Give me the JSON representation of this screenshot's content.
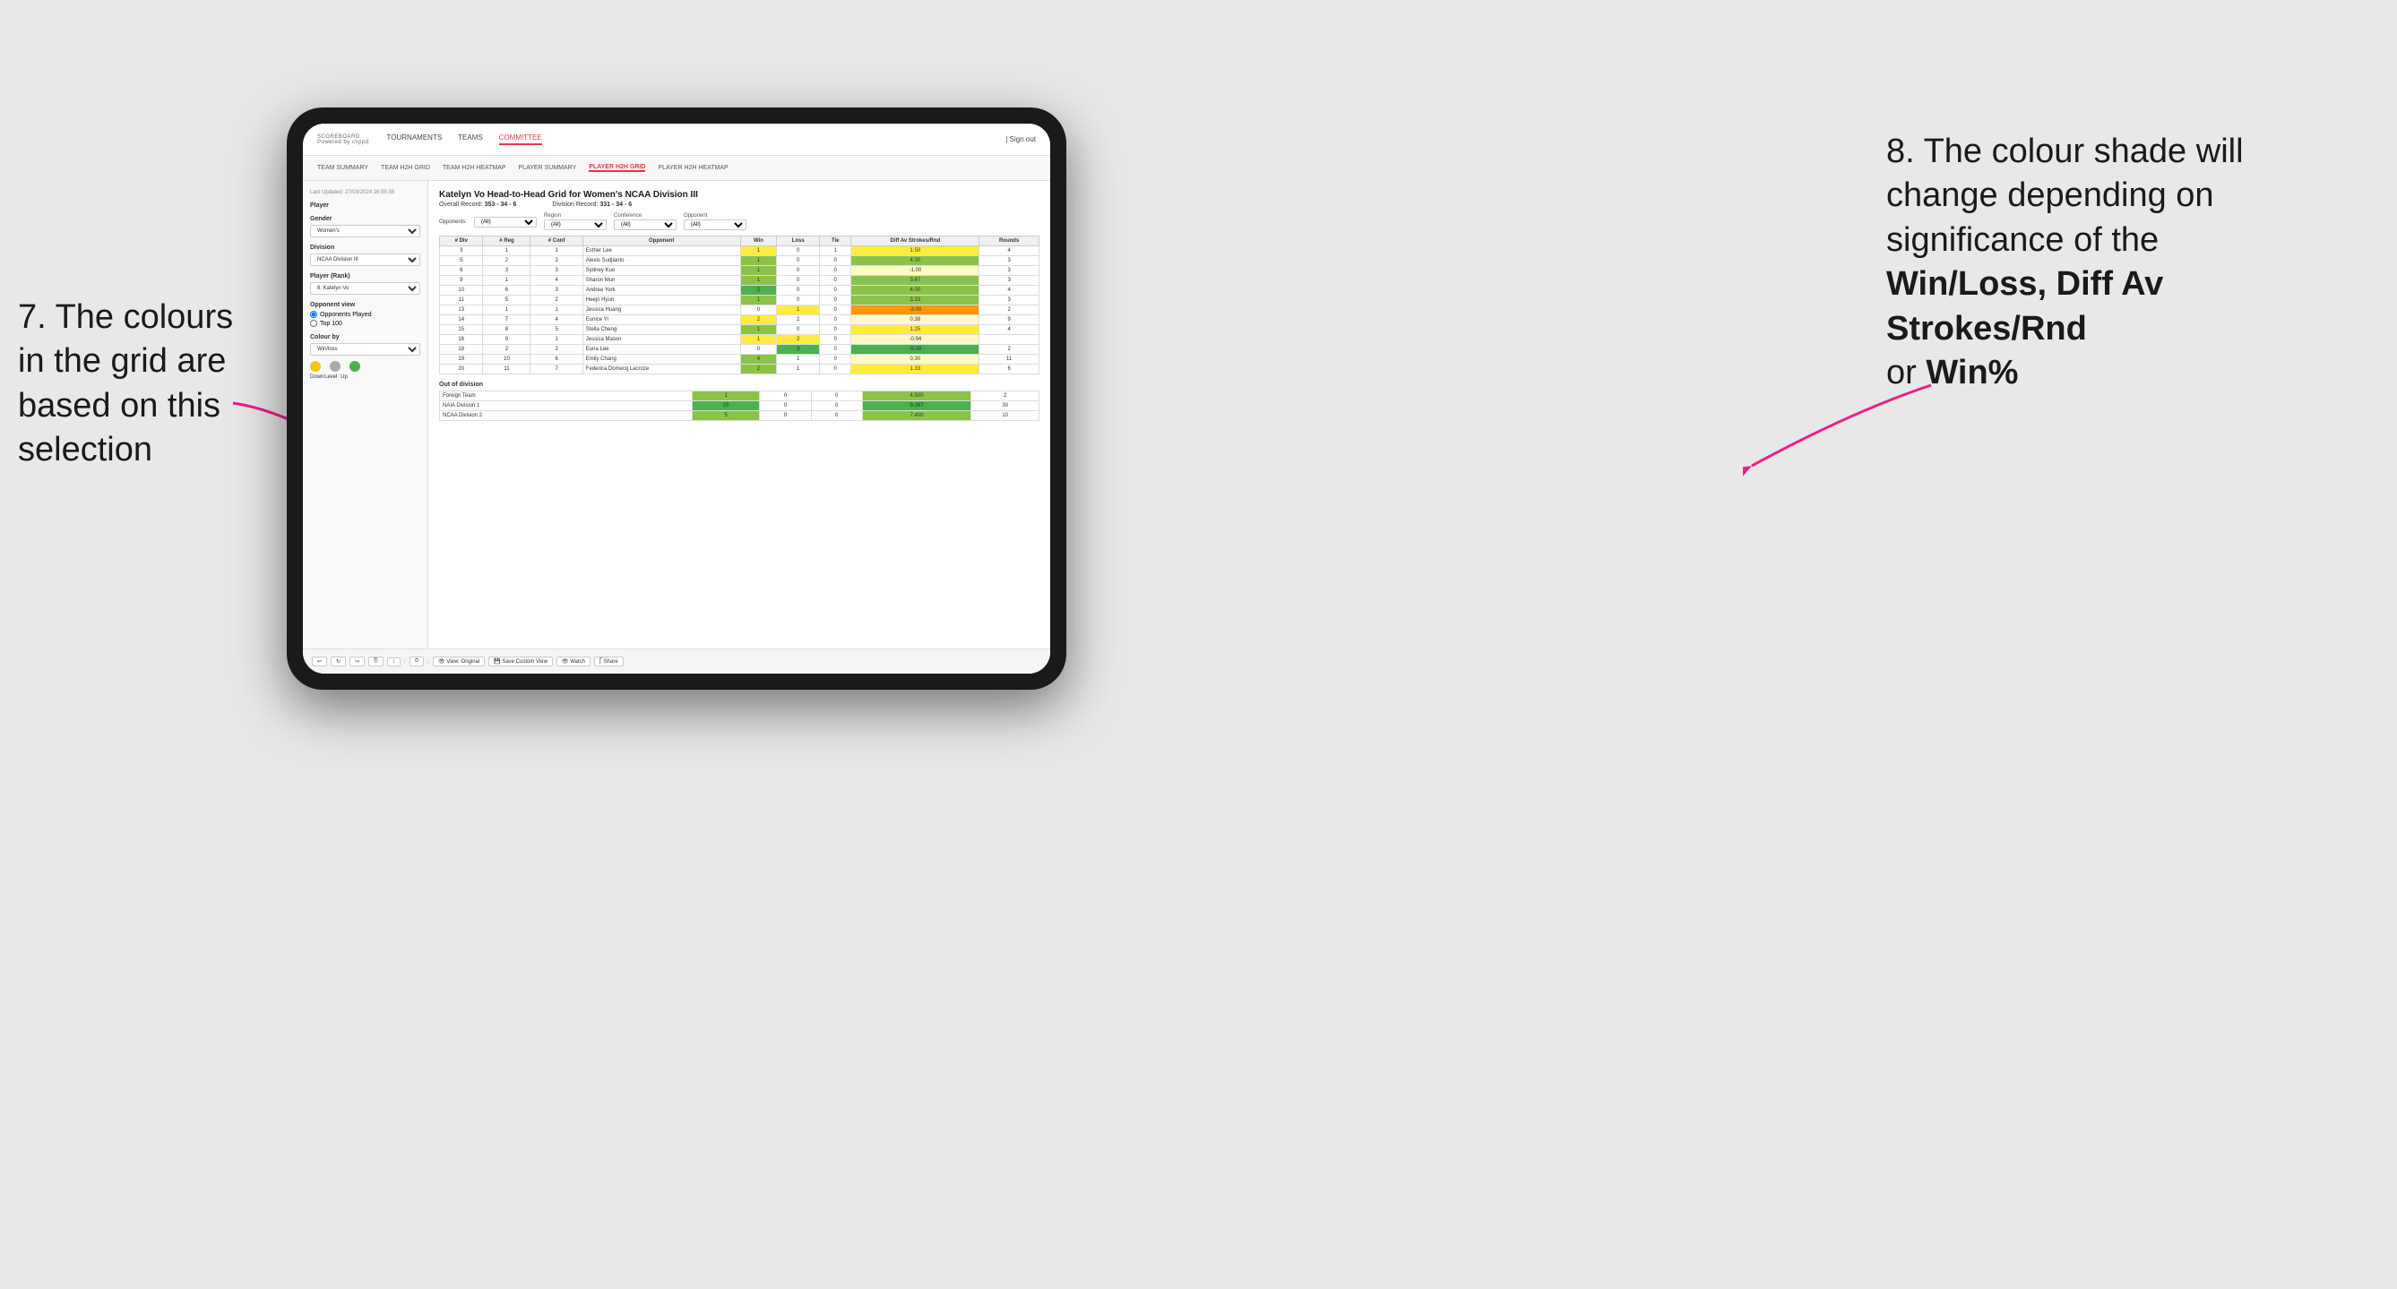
{
  "annotations": {
    "left_title": "7. The colours in the grid are based on this selection",
    "right_title": "8. The colour shade will change depending on significance of the",
    "right_bold1": "Win/Loss,",
    "right_bold2": "Diff Av Strokes/Rnd",
    "right_or": "or",
    "right_bold3": "Win%"
  },
  "nav": {
    "logo": "SCOREBOARD",
    "logo_sub": "Powered by clippd",
    "links": [
      "TOURNAMENTS",
      "TEAMS",
      "COMMITTEE"
    ],
    "active_link": "COMMITTEE",
    "right": "| Sign out"
  },
  "sub_nav": {
    "links": [
      "TEAM SUMMARY",
      "TEAM H2H GRID",
      "TEAM H2H HEATMAP",
      "PLAYER SUMMARY",
      "PLAYER H2H GRID",
      "PLAYER H2H HEATMAP"
    ],
    "active": "PLAYER H2H GRID"
  },
  "sidebar": {
    "timestamp": "Last Updated: 27/03/2024 16:55:38",
    "player_label": "Player",
    "gender_label": "Gender",
    "gender_value": "Women's",
    "division_label": "Division",
    "division_value": "NCAA Division III",
    "player_rank_label": "Player (Rank)",
    "player_rank_value": "8. Katelyn Vo",
    "opponent_view_label": "Opponent view",
    "opponent_played": "Opponents Played",
    "top_100": "Top 100",
    "colour_by_label": "Colour by",
    "colour_by_value": "Win/loss",
    "dots": [
      "Down",
      "Level",
      "Up"
    ]
  },
  "grid": {
    "title": "Katelyn Vo Head-to-Head Grid for Women's NCAA Division III",
    "overall_record_label": "Overall Record:",
    "overall_record": "353 - 34 - 6",
    "division_record_label": "Division Record:",
    "division_record": "331 - 34 - 6",
    "filters": {
      "opponents_label": "Opponents:",
      "opponents_value": "(All)",
      "region_label": "Region",
      "region_value": "(All)",
      "conference_label": "Conference",
      "conference_value": "(All)",
      "opponent_label": "Opponent",
      "opponent_value": "(All)"
    },
    "table_headers": [
      "# Div",
      "# Reg",
      "# Conf",
      "Opponent",
      "Win",
      "Loss",
      "Tie",
      "Diff Av Strokes/Rnd",
      "Rounds"
    ],
    "rows": [
      {
        "div": "3",
        "reg": "1",
        "conf": "1",
        "opponent": "Esther Lee",
        "win": "1",
        "loss": "0",
        "tie": "1",
        "diff": "1.50",
        "rounds": "4",
        "win_color": "yellow",
        "loss_color": "",
        "diff_color": "yellow"
      },
      {
        "div": "5",
        "reg": "2",
        "conf": "2",
        "opponent": "Alexis Sudjianto",
        "win": "1",
        "loss": "0",
        "tie": "0",
        "diff": "4.00",
        "rounds": "3",
        "win_color": "green",
        "diff_color": "green"
      },
      {
        "div": "6",
        "reg": "3",
        "conf": "3",
        "opponent": "Sydney Kuo",
        "win": "1",
        "loss": "0",
        "tie": "0",
        "diff": "-1.00",
        "rounds": "3",
        "win_color": "green",
        "diff_color": "pale-yellow"
      },
      {
        "div": "9",
        "reg": "1",
        "conf": "4",
        "opponent": "Sharon Mun",
        "win": "1",
        "loss": "0",
        "tie": "0",
        "diff": "3.67",
        "rounds": "3",
        "win_color": "green",
        "diff_color": "green"
      },
      {
        "div": "10",
        "reg": "6",
        "conf": "3",
        "opponent": "Andrea York",
        "win": "2",
        "loss": "0",
        "tie": "0",
        "diff": "4.00",
        "rounds": "4",
        "win_color": "green-strong",
        "diff_color": "green"
      },
      {
        "div": "11",
        "reg": "5",
        "conf": "2",
        "opponent": "Heejo Hyun",
        "win": "1",
        "loss": "0",
        "tie": "0",
        "diff": "3.33",
        "rounds": "3",
        "win_color": "green",
        "diff_color": "green"
      },
      {
        "div": "13",
        "reg": "1",
        "conf": "1",
        "opponent": "Jessica Huang",
        "win": "0",
        "loss": "1",
        "tie": "0",
        "diff": "-3.00",
        "rounds": "2",
        "win_color": "",
        "loss_color": "yellow",
        "diff_color": "orange"
      },
      {
        "div": "14",
        "reg": "7",
        "conf": "4",
        "opponent": "Eunice Yi",
        "win": "2",
        "loss": "2",
        "tie": "0",
        "diff": "0.38",
        "rounds": "9",
        "win_color": "yellow",
        "diff_color": "pale-yellow"
      },
      {
        "div": "15",
        "reg": "8",
        "conf": "5",
        "opponent": "Stella Cheng",
        "win": "1",
        "loss": "0",
        "tie": "0",
        "diff": "1.25",
        "rounds": "4",
        "win_color": "green",
        "diff_color": "yellow"
      },
      {
        "div": "16",
        "reg": "9",
        "conf": "1",
        "opponent": "Jessica Mason",
        "win": "1",
        "loss": "2",
        "tie": "0",
        "diff": "-0.94",
        "rounds": "",
        "win_color": "yellow",
        "loss_color": "yellow",
        "diff_color": "pale-yellow"
      },
      {
        "div": "18",
        "reg": "2",
        "conf": "2",
        "opponent": "Euna Lee",
        "win": "0",
        "loss": "3",
        "tie": "0",
        "diff": "-5.00",
        "rounds": "2",
        "win_color": "",
        "loss_color": "green-strong",
        "diff_color": "green-strong"
      },
      {
        "div": "19",
        "reg": "10",
        "conf": "6",
        "opponent": "Emily Chang",
        "win": "4",
        "loss": "1",
        "tie": "0",
        "diff": "0.30",
        "rounds": "11",
        "win_color": "green",
        "diff_color": "pale-yellow"
      },
      {
        "div": "20",
        "reg": "11",
        "conf": "7",
        "opponent": "Federica Domecq Lacroze",
        "win": "2",
        "loss": "1",
        "tie": "0",
        "diff": "1.33",
        "rounds": "6",
        "win_color": "green",
        "diff_color": "yellow"
      }
    ],
    "out_of_division_label": "Out of division",
    "out_of_division_rows": [
      {
        "opponent": "Foreign Team",
        "win": "1",
        "loss": "0",
        "tie": "0",
        "diff": "4.500",
        "rounds": "2",
        "win_color": "green"
      },
      {
        "opponent": "NAIA Division 1",
        "win": "15",
        "loss": "0",
        "tie": "0",
        "diff": "9.267",
        "rounds": "30",
        "win_color": "green-strong"
      },
      {
        "opponent": "NCAA Division 2",
        "win": "5",
        "loss": "0",
        "tie": "0",
        "diff": "7.400",
        "rounds": "10",
        "win_color": "green"
      }
    ]
  },
  "toolbar": {
    "view_original": "View: Original",
    "save_custom": "Save Custom View",
    "watch": "Watch",
    "share": "Share"
  }
}
